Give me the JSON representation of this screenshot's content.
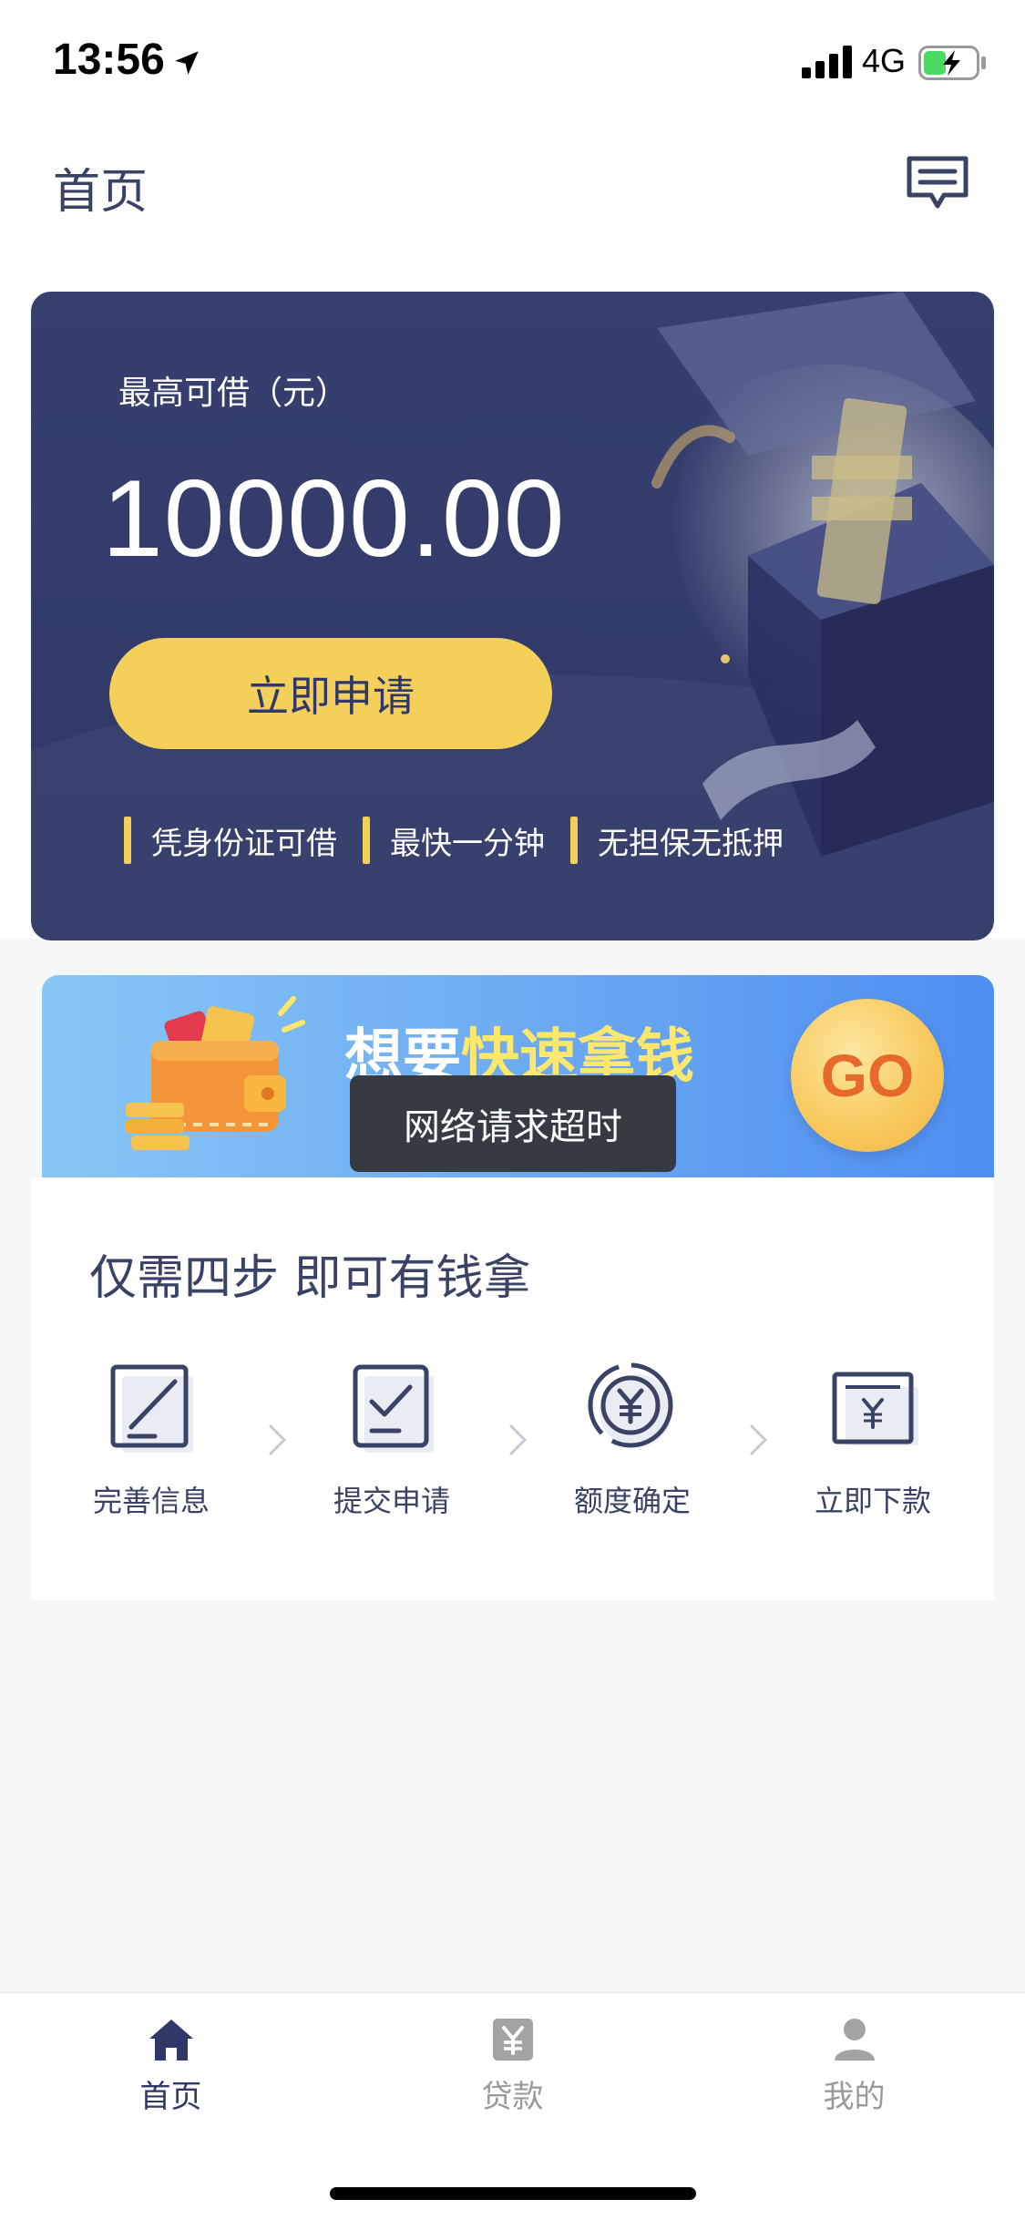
{
  "status_bar": {
    "time": "13:56",
    "network": "4G"
  },
  "header": {
    "title": "首页",
    "message_icon": "message-icon"
  },
  "hero": {
    "label": "最高可借（元）",
    "amount": "10000.00",
    "apply_label": "立即申请",
    "features": [
      "凭身份证可借",
      "最快一分钟",
      "无担保无抵押"
    ]
  },
  "promo": {
    "text_prefix": "想要",
    "text_highlight": "快速拿钱",
    "go_label": "GO"
  },
  "toast": {
    "message": "网络请求超时"
  },
  "steps": {
    "title": "仅需四步 即可有钱拿",
    "items": [
      {
        "label": "完善信息",
        "icon": "edit-icon"
      },
      {
        "label": "提交申请",
        "icon": "checklist-icon"
      },
      {
        "label": "额度确定",
        "icon": "yuan-coin-icon"
      },
      {
        "label": "立即下款",
        "icon": "yuan-wallet-icon"
      }
    ]
  },
  "tabs": {
    "items": [
      {
        "label": "首页",
        "icon": "home-icon",
        "active": true
      },
      {
        "label": "贷款",
        "icon": "loan-icon",
        "active": false
      },
      {
        "label": "我的",
        "icon": "user-icon",
        "active": false
      }
    ]
  },
  "colors": {
    "accent": "#f4d05a",
    "hero_bg": "#363f6e",
    "text_dark": "#3a4266",
    "promo_highlight": "#fde86b"
  }
}
